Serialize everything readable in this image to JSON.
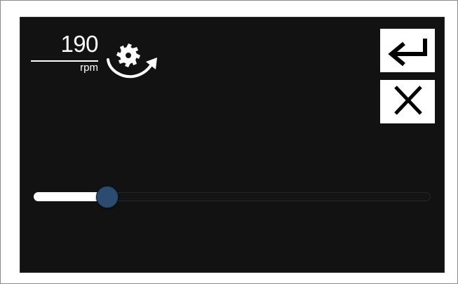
{
  "speed": {
    "value": "190",
    "unit": "rpm"
  },
  "icons": {
    "spindle": "saw-blade-rotation-icon",
    "enter": "enter-return-icon",
    "cancel": "close-x-icon"
  },
  "slider": {
    "fraction": 0.185
  },
  "colors": {
    "screen_background": "#121212",
    "foreground": "#ffffff",
    "slider_thumb": "#2c4b70"
  }
}
